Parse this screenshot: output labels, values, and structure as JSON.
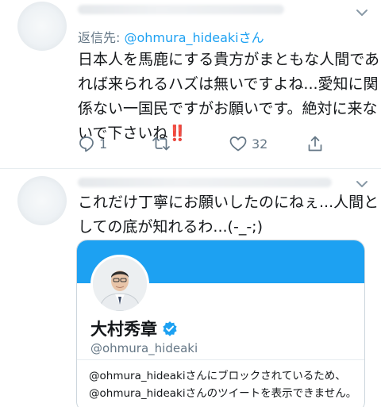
{
  "tweet1": {
    "reply_label": "返信先: ",
    "reply_handle": "@ohmura_hideakiさん",
    "lines": [
      "日本人を馬鹿にする貴方がまともな人間であ",
      "れば来られるハズは無いですよね...愛知に関",
      "係ない一国民ですがお願いです。絶対に来な",
      "いで下さいね"
    ],
    "emphasis": "‼️",
    "reply_count": "1",
    "like_count": "32",
    "icons": [
      "reply-icon",
      "retweet-icon",
      "like-icon",
      "share-icon",
      "chevron-down-icon"
    ]
  },
  "tweet2": {
    "lines": [
      "これだけ丁寧にお願いしたのにねぇ...人間と",
      "しての底が知れるわ...(-_-;)"
    ],
    "icons": [
      "chevron-down-icon"
    ]
  },
  "card": {
    "name": "大村秀章",
    "handle": "@ohmura_hideaki",
    "notice_lines": [
      "@ohmura_hideakiさんにブロックされているため、",
      "@ohmura_hideakiさんのツイートを表示できません。"
    ],
    "icons": [
      "verified-badge-icon"
    ]
  },
  "colors": {
    "accent": "#1da1f2",
    "muted": "#657786",
    "text": "#14171a",
    "border": "#ccd6dd",
    "emphasis": "#d0342c"
  }
}
